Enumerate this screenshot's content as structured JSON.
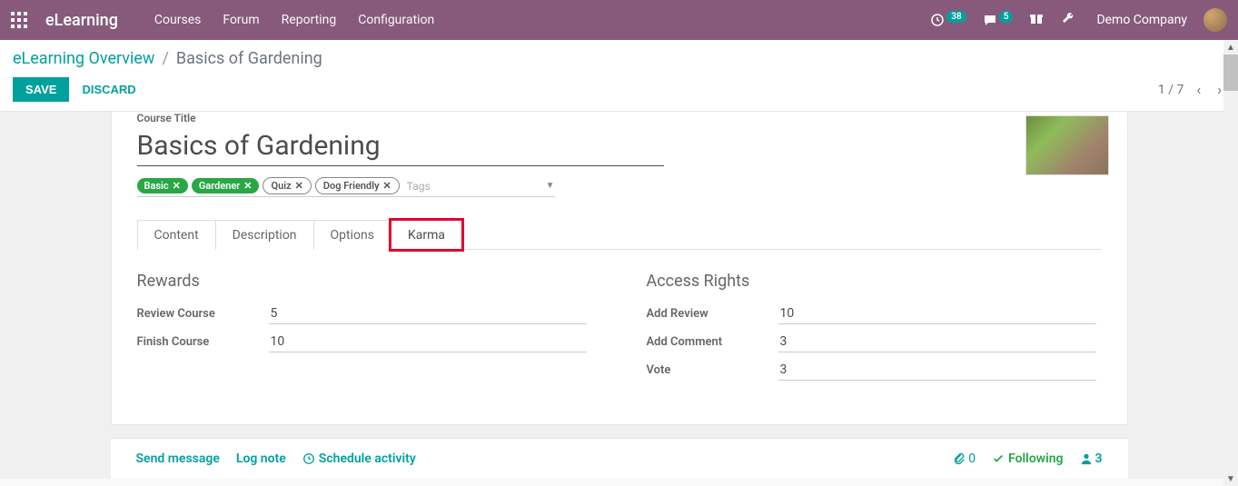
{
  "topbar": {
    "brand": "eLearning",
    "nav": [
      "Courses",
      "Forum",
      "Reporting",
      "Configuration"
    ],
    "activity_count": "38",
    "message_count": "5",
    "company": "Demo Company"
  },
  "breadcrumb": {
    "parent": "eLearning Overview",
    "current": "Basics of Gardening"
  },
  "actions": {
    "save": "SAVE",
    "discard": "DISCARD",
    "pager": "1 / 7"
  },
  "form": {
    "title_label": "Course Title",
    "title": "Basics of Gardening",
    "tags": {
      "items": [
        "Basic",
        "Gardener",
        "Quiz",
        "Dog Friendly"
      ],
      "placeholder": "Tags"
    },
    "tabs": [
      "Content",
      "Description",
      "Options",
      "Karma"
    ],
    "active_tab": "Karma",
    "rewards": {
      "title": "Rewards",
      "review_course_label": "Review Course",
      "review_course": "5",
      "finish_course_label": "Finish Course",
      "finish_course": "10"
    },
    "access": {
      "title": "Access Rights",
      "add_review_label": "Add Review",
      "add_review": "10",
      "add_comment_label": "Add Comment",
      "add_comment": "3",
      "vote_label": "Vote",
      "vote": "3"
    }
  },
  "chatter": {
    "send_message": "Send message",
    "log_note": "Log note",
    "schedule": "Schedule activity",
    "attachments": "0",
    "following": "Following",
    "followers": "3"
  }
}
